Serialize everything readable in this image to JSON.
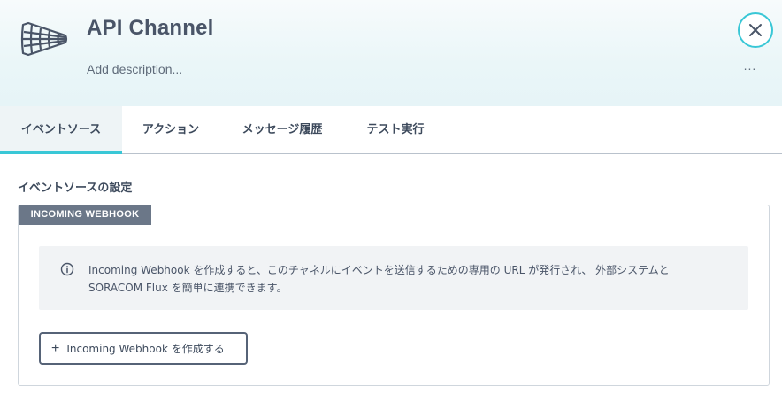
{
  "header": {
    "title": "API Channel",
    "description_placeholder": "Add description...",
    "more_label": "...",
    "icons": {
      "channel": "funnel-net-icon",
      "close": "close-icon"
    }
  },
  "tabs": [
    {
      "label": "イベントソース",
      "active": true
    },
    {
      "label": "アクション",
      "active": false
    },
    {
      "label": "メッセージ履歴",
      "active": false
    },
    {
      "label": "テスト実行",
      "active": false
    }
  ],
  "section": {
    "title": "イベントソースの設定",
    "card": {
      "badge": "INCOMING WEBHOOK",
      "info": {
        "icon": "info-icon",
        "line1": "Incoming Webhook を作成すると、このチャネルにイベントを送信するための専用の URL が発行され、 外部システムと",
        "line2": "SORACOM Flux を簡単に連携できます。"
      },
      "create_button": {
        "plus": "+",
        "label": "Incoming Webhook を作成する"
      }
    }
  },
  "colors": {
    "accent": "#39c7d6",
    "text": "#3d4a5c",
    "badge_bg": "#6b7788",
    "info_bg": "#f1f3f5"
  }
}
